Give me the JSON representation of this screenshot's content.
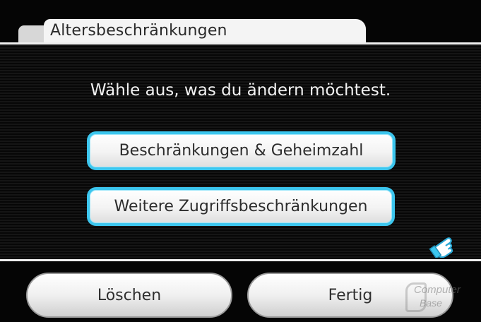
{
  "header": {
    "title": "Altersbeschränkungen"
  },
  "main": {
    "prompt": "Wähle aus, was du ändern möchtest.",
    "options": [
      {
        "label": "Beschränkungen & Geheimzahl"
      },
      {
        "label": "Weitere Zugriffsbeschränkungen"
      }
    ]
  },
  "footer": {
    "clear_label": "Löschen",
    "done_label": "Fertig"
  },
  "watermark": {
    "line1": "Computer",
    "line2": "Base"
  },
  "cursor": {
    "icon": "wii-pointer-hand-icon"
  },
  "colors": {
    "accent": "#3cc6ee",
    "background": "#000000",
    "panel_line": "#efefef"
  }
}
